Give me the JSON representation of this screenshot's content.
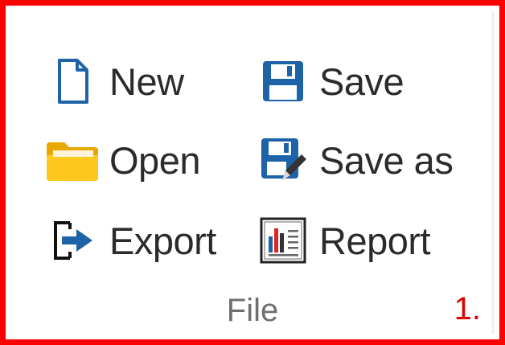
{
  "group": {
    "label": "File",
    "annotation": "1.",
    "frame_color": "#ff0000"
  },
  "commands": {
    "new": {
      "label": "New",
      "icon": "new-document-icon"
    },
    "save": {
      "label": "Save",
      "icon": "floppy-disk-icon"
    },
    "open": {
      "label": "Open",
      "icon": "folder-icon"
    },
    "save_as": {
      "label": "Save as",
      "icon": "floppy-disk-pen-icon"
    },
    "export": {
      "label": "Export",
      "icon": "export-arrow-icon"
    },
    "report": {
      "label": "Report",
      "icon": "report-chart-icon"
    }
  },
  "colors": {
    "icon_blue": "#1e63a8",
    "folder_yellow": "#f4c430",
    "report_red": "#e02424",
    "text": "#2b2b2b",
    "group_label": "#6f6f6f"
  }
}
